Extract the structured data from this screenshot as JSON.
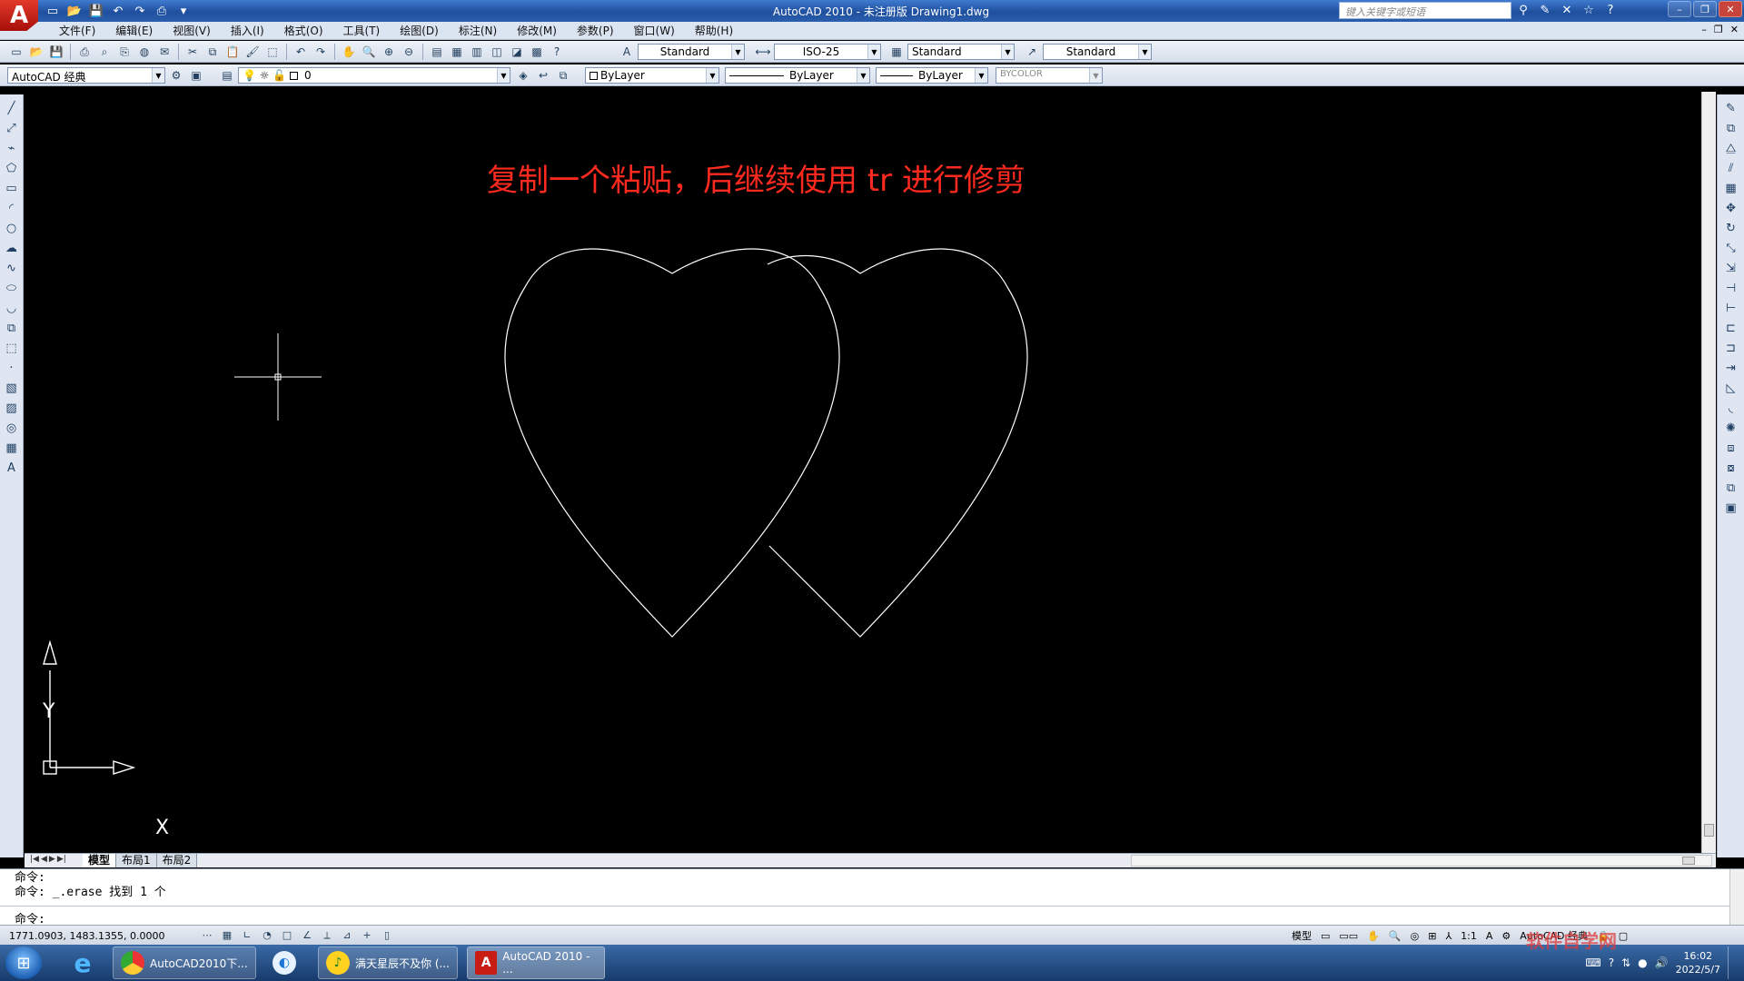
{
  "window": {
    "title": "AutoCAD 2010 - 未注册版      Drawing1.dwg",
    "search_placeholder": "键入关键字或短语",
    "logo_letter": "A"
  },
  "menu": {
    "items": [
      "文件(F)",
      "编辑(E)",
      "视图(V)",
      "插入(I)",
      "格式(O)",
      "工具(T)",
      "绘图(D)",
      "标注(N)",
      "修改(M)",
      "参数(P)",
      "窗口(W)",
      "帮助(H)"
    ]
  },
  "toolbar": {
    "text_style": "Standard",
    "dim_style": "ISO-25",
    "table_style": "Standard",
    "multileader_style": "Standard",
    "workspace": "AutoCAD 经典",
    "layer": "0",
    "color": "ByLayer",
    "linetype": "ByLayer",
    "lineweight": "ByLayer",
    "plot_style": "BYCOLOR"
  },
  "canvas": {
    "annotation": "复制一个粘贴，后继续使用 tr 进行修剪",
    "annotation_color": "#ff2a1f",
    "ucs_x": "X",
    "ucs_y": "Y"
  },
  "layout_tabs": [
    "模型",
    "布局1",
    "布局2"
  ],
  "command": {
    "history": [
      "命令:",
      "命令: _.erase 找到 1 个"
    ],
    "prompt": "命令:"
  },
  "status": {
    "coords": "1771.0903, 1483.1355, 0.0000",
    "model_label": "模型",
    "scale": "1:1",
    "workspace": "AutoCAD 经典"
  },
  "taskbar": {
    "items": [
      "AutoCAD2010下...",
      "满天星辰不及你 (...",
      "AutoCAD 2010 - ..."
    ],
    "time": "16:02",
    "date": "2022/5/7"
  },
  "watermark": "软件自学网"
}
